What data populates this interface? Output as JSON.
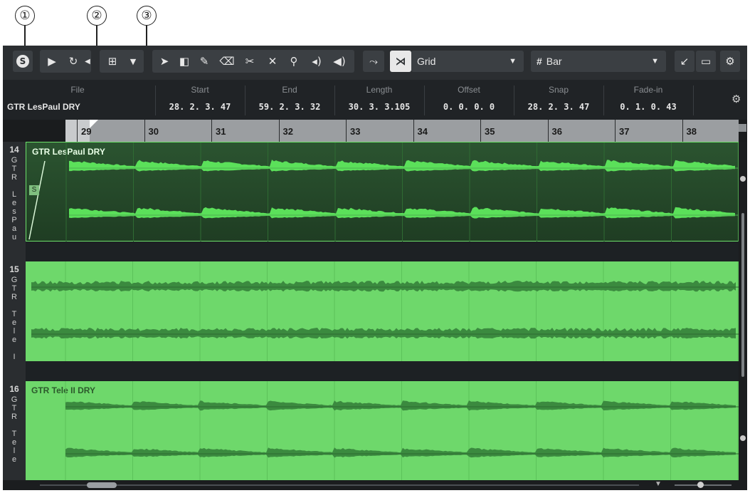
{
  "callouts": [
    "①",
    "②",
    "③"
  ],
  "toolbar": {
    "solo_icon": "solo-icon",
    "play_icon": "play-icon",
    "loop_icon": "loop-icon",
    "snap_mode_icon": "snap-mode-icon",
    "select_tool_icon": "arrow-tool-icon",
    "range_tool_icon": "range-tool-icon",
    "draw_tool_icon": "pencil-icon",
    "erase_tool_icon": "eraser-icon",
    "split_tool_icon": "scissors-icon",
    "mute_tool_icon": "mute-x-icon",
    "zoom_tool_icon": "zoom-icon",
    "scrub_tool_icon": "scrub-icon",
    "audition_tool_icon": "speaker-icon",
    "grid_type": "Grid",
    "quantize": "Bar",
    "quantize_icon": "hash-icon"
  },
  "infoline": {
    "file_label": "File",
    "file_value": "GTR LesPaul DRY",
    "fields": [
      {
        "label": "Start",
        "value": "28. 2. 3. 47"
      },
      {
        "label": "End",
        "value": "59. 2. 3. 32"
      },
      {
        "label": "Length",
        "value": "30. 3. 3.105"
      },
      {
        "label": "Offset",
        "value": "0. 0. 0.  0"
      },
      {
        "label": "Snap",
        "value": "28. 2. 3. 47"
      },
      {
        "label": "Fade-in",
        "value": "0. 1. 0. 43"
      }
    ]
  },
  "ruler": {
    "bars": [
      "29",
      "30",
      "31",
      "32",
      "33",
      "34",
      "35",
      "36",
      "37",
      "38"
    ]
  },
  "tracks": [
    {
      "number": "14",
      "vertical_name": [
        "G",
        "T",
        "R",
        "",
        "L",
        "e",
        "s",
        "P",
        "a",
        "u"
      ],
      "clip_title": "GTR LesPaul DRY",
      "selected": true,
      "marker": "S"
    },
    {
      "number": "15",
      "vertical_name": [
        "G",
        "T",
        "R",
        "",
        "T",
        "e",
        "l",
        "e",
        "",
        "I"
      ],
      "clip_title": "",
      "selected": false
    },
    {
      "number": "16",
      "vertical_name": [
        "G",
        "T",
        "R",
        "",
        "T",
        "e",
        "l",
        "e"
      ],
      "clip_title": "GTR Tele II DRY",
      "selected": false
    }
  ],
  "colors": {
    "window_bg": "#1f2224",
    "clip_green_light": "#6fd36a",
    "clip_green_dark": "#1b3a1e",
    "waveform_bright": "#5be05a",
    "waveform_dark": "#3b8a3f"
  }
}
